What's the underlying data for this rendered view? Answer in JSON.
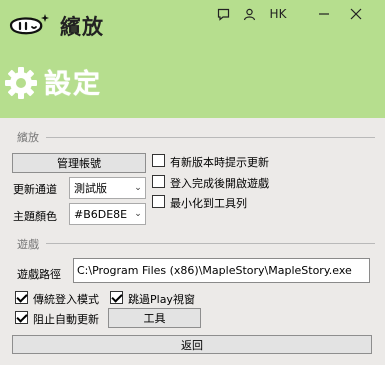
{
  "app": {
    "name": "繽放",
    "lang": "HK"
  },
  "header": {
    "title": "設定"
  },
  "sections": {
    "bloom": "繽放",
    "game": "遊戲"
  },
  "bloom": {
    "manage_account_label": "管理帳號",
    "update_channel_label": "更新通道",
    "update_channel_value": "測試版",
    "theme_color_label": "主題顏色",
    "theme_color_value": "#B6DE8E",
    "options": [
      {
        "label": "有新版本時提示更新",
        "checked": false
      },
      {
        "label": "登入完成後開啟遊戲",
        "checked": false
      },
      {
        "label": "最小化到工具列",
        "checked": false
      }
    ]
  },
  "game": {
    "path_label": "遊戲路徑",
    "path_value": "C:\\Program Files (x86)\\MapleStory\\MapleStory.exe",
    "options": [
      {
        "label": "傳統登入模式",
        "checked": true
      },
      {
        "label": "跳過Play視窗",
        "checked": true
      },
      {
        "label": "阻止自動更新",
        "checked": true
      }
    ],
    "tools_label": "工具"
  },
  "footer": {
    "back_label": "返回"
  },
  "colors": {
    "accent": "#B6DE8E",
    "panel": "#ECEAE8",
    "title_text": "#FFFFFF"
  },
  "icons": [
    "app-logo-icon",
    "chat-icon",
    "user-icon",
    "minimize-icon",
    "close-icon",
    "gear-icon",
    "chevron-down-icon",
    "checkmark-icon"
  ]
}
